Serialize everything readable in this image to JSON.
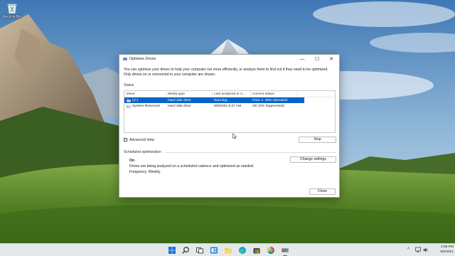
{
  "desktop": {
    "icons": [
      {
        "label": "Recycle Bin",
        "icon": "recycle-bin-icon"
      }
    ]
  },
  "window": {
    "title": "Optimize Drives",
    "app_icon": "optimize-drives-icon",
    "controls": {
      "minimize": "—",
      "maximize": "☐",
      "close": "✕"
    },
    "description": "You can optimize your drives to help your computer run more efficiently, or analyze them to find out if they need to be optimized. Only drives on or connected to your computer are shown.",
    "status_label": "Status",
    "columns": [
      "Drive",
      "Media type",
      "Last analyzed or o...",
      "Current status"
    ],
    "rows": [
      {
        "drive": "(C:)",
        "media": "Hard disk drive",
        "last": "Running...",
        "status": "Pass 1: 48% relocated",
        "selected": true,
        "icon": "hard-drive-windows-icon"
      },
      {
        "drive": "System Reserved",
        "media": "Hard disk drive",
        "last": "8/5/2021 8:27 AM",
        "status": "OK (0% fragmented)",
        "selected": false,
        "icon": "hard-drive-icon"
      }
    ],
    "advanced_view_label": "Advanced View",
    "advanced_view_checked": false,
    "stop_button": "Stop",
    "scheduled_label": "Scheduled optimization",
    "scheduled_state": "On",
    "scheduled_description": "Drives are being analyzed on a scheduled cadence and optimized as needed.",
    "frequency": "Frequency: Weekly",
    "change_settings_button": "Change settings",
    "close_button": "Close"
  },
  "taskbar": {
    "icons": [
      "start-icon",
      "search-icon",
      "task-view-icon",
      "widgets-icon",
      "file-explorer-icon",
      "edge-icon",
      "store-icon",
      "chrome-icon",
      "defragment-icon"
    ],
    "tray_chevron": "^",
    "time": "2:58 PM",
    "date": "8/5/2021"
  },
  "colors": {
    "selection": "#0a64c8",
    "accent": "#0078d4"
  }
}
